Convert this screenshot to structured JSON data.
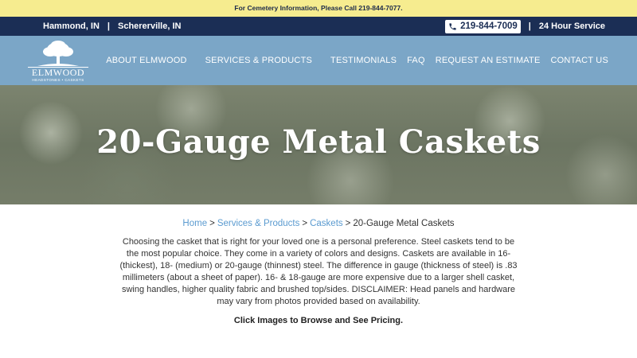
{
  "announcement": "For Cemetery Information, Please Call 219-844-7077.",
  "topbar": {
    "location_1": "Hammond, IN",
    "separator": "|",
    "location_2": "Schererville, IN",
    "phone": "219-844-7009",
    "service": "24 Hour Service"
  },
  "logo": {
    "name": "ELMWOOD",
    "tagline": "HEADSTONES • CASKETS"
  },
  "nav": {
    "items": [
      {
        "label": "ABOUT ELMWOOD"
      },
      {
        "label": "SERVICES & PRODUCTS"
      },
      {
        "label": "TESTIMONIALS"
      },
      {
        "label": "FAQ"
      },
      {
        "label": "REQUEST AN ESTIMATE"
      },
      {
        "label": "CONTACT US"
      }
    ]
  },
  "hero": {
    "title": "20-Gauge Metal Caskets"
  },
  "breadcrumb": {
    "home": "Home",
    "services": "Services & Products",
    "caskets": "Caskets",
    "current": "20-Gauge Metal Caskets",
    "separator": ">"
  },
  "content": {
    "description": "Choosing the casket that is right for your loved one is a personal preference. Steel caskets tend to be the most popular choice. They come in a variety of colors and designs. Caskets are available in 16- (thickest), 18- (medium) or 20-gauge (thinnest) steel. The difference in gauge (thickness of steel) is .83 millimeters (about a sheet of paper). 16- & 18-gauge are more expensive due to a larger shell casket, swing handles, higher quality fabric and brushed top/sides. DISCLAIMER: Head panels and hardware may vary from photos provided based on availability.",
    "cta": "Click Images to Browse and See Pricing."
  },
  "colors": {
    "announcement_bg": "#f6ec8f",
    "topbar_bg": "#1b2e55",
    "navbar_bg": "#7ba6c7",
    "link": "#5b9bd0"
  }
}
